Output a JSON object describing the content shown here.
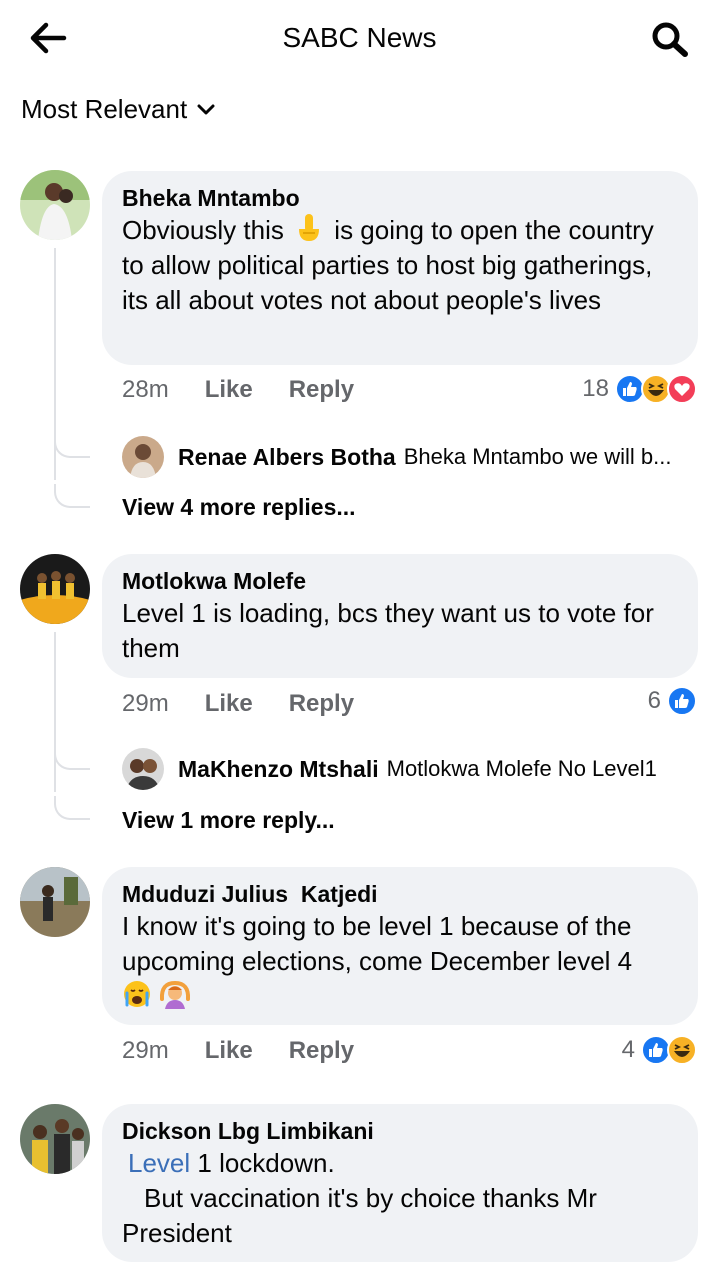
{
  "header": {
    "title": "SABC News",
    "back_icon": "back-arrow-icon",
    "search_icon": "search-icon"
  },
  "sort": {
    "label": "Most Relevant",
    "icon": "chevron-down-icon"
  },
  "comments": [
    {
      "author": "Bheka Mntambo",
      "text_before": "Obviously this",
      "emoji": "finger-emoji",
      "text_after": " is going to open the country to allow political parties to host big gatherings, its all about votes not about people's lives",
      "time": "28m",
      "like": "Like",
      "reply": "Reply",
      "reaction_count": "18",
      "reactions": [
        "like",
        "haha",
        "love"
      ],
      "reply_preview": {
        "name": "Renae Albers Botha",
        "text": "Bheka Mntambo we will b..."
      },
      "more_replies": "View 4 more replies..."
    },
    {
      "author": "Motlokwa Molefe",
      "text": "Level 1 is loading, bcs they want us to vote for them",
      "time": "29m",
      "like": "Like",
      "reply": "Reply",
      "reaction_count": "6",
      "reactions": [
        "like"
      ],
      "reply_preview": {
        "name": "MaKhenzo Mtshali",
        "text": "Motlokwa Molefe No Level1"
      },
      "more_replies": "View 1 more reply..."
    },
    {
      "author": "Mduduzi Julius  Katjedi",
      "text": "I know it's going to be level 1 because of the upcoming elections, come December level 4",
      "emojis": [
        "crying-emoji",
        "woman-gesturing-ok-emoji"
      ],
      "time": "29m",
      "like": "Like",
      "reply": "Reply",
      "reaction_count": "4",
      "reactions": [
        "like",
        "haha"
      ]
    },
    {
      "author": "Dickson Lbg Limbikani",
      "link_word": "Level",
      "text_line1": " 1 lockdown.",
      "text_line2": "But vaccination it's by choice thanks Mr President"
    }
  ],
  "colors": {
    "bubble": "#f0f2f5",
    "secondary_text": "#65676b",
    "like_blue": "#1877f2",
    "love_red": "#f33e58",
    "haha_yellow": "#f7b125",
    "link": "#3b6fb8"
  }
}
